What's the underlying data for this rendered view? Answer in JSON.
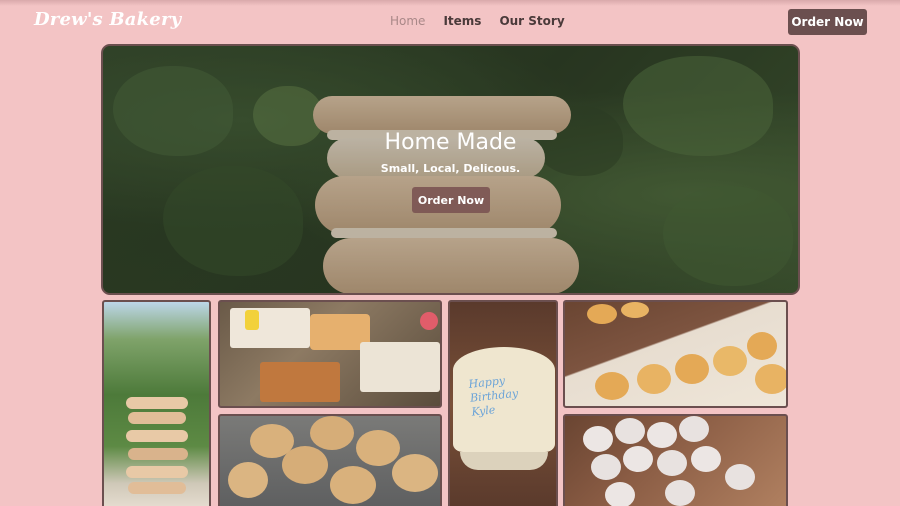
{
  "brand": {
    "name": "Drew's Bakery"
  },
  "nav": {
    "links": [
      {
        "label": "Home",
        "active": true
      },
      {
        "label": "Items",
        "active": false
      },
      {
        "label": "Our Story",
        "active": false
      }
    ],
    "cta_label": "Order Now"
  },
  "hero": {
    "title": "Home Made",
    "subtitle": "Small, Local, Delicous.",
    "cta_label": "Order Now"
  },
  "gallery": {
    "photos": [
      {
        "subject": "macaron-stack"
      },
      {
        "subject": "party-table-treats"
      },
      {
        "subject": "birthday-cake",
        "cake_text": "Happy Birthday Kyle"
      },
      {
        "subject": "cream-puffs"
      },
      {
        "subject": "blueberry-muffins"
      },
      {
        "subject": "frosted-cupcakes"
      }
    ]
  },
  "colors": {
    "background": "#f3c4c5",
    "accent": "#6b4f4f",
    "text_dark": "#4a3a3a"
  }
}
